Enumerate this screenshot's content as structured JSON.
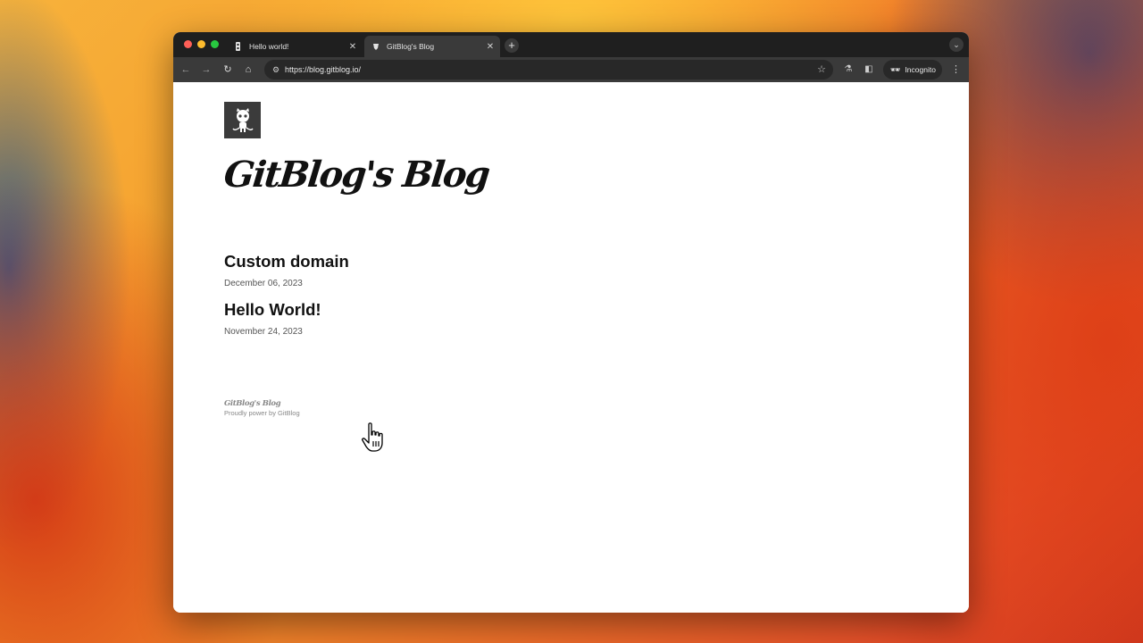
{
  "browser": {
    "tabs": [
      {
        "title": "Hello world!",
        "active": false
      },
      {
        "title": "GitBlog's Blog",
        "active": true
      }
    ],
    "new_tab_icon": "plus-icon",
    "address": "https://blog.gitblog.io/",
    "incognito_label": "Incognito"
  },
  "blog": {
    "title": "GitBlog's Blog",
    "posts": [
      {
        "title": "Custom domain",
        "date": "December 06, 2023"
      },
      {
        "title": "Hello World!",
        "date": "November 24, 2023"
      }
    ],
    "footer": {
      "name": "GitBlog's Blog",
      "powered": "Proudly power by GitBlog"
    }
  },
  "colors": {
    "tabbar": "#1f1f1f",
    "toolbar": "#3a3a3a",
    "logo_bg": "#3b3b3b"
  }
}
